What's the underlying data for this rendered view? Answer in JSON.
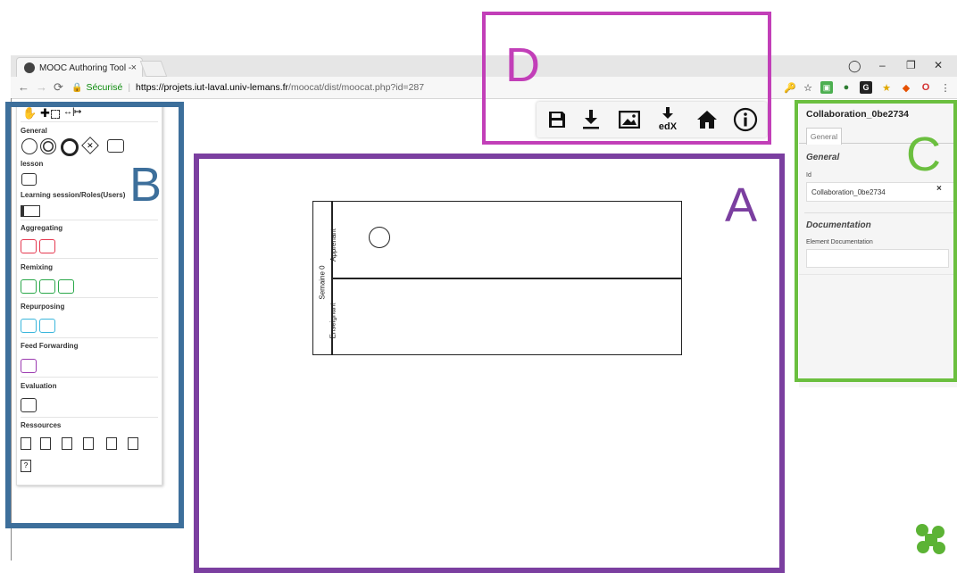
{
  "browser": {
    "tab_title": "MOOC Authoring Tool - ",
    "tab_close": "×",
    "secure_label": "Sécurisé",
    "url_host": "https://projets.iut-laval.univ-lemans.fr",
    "url_path": "/moocat/dist/moocat.php?id=287",
    "window_controls": [
      "–",
      "❐",
      "✕"
    ]
  },
  "palette": {
    "sections": {
      "general": "General",
      "lesson": "lesson",
      "learning_session": "Learning session/Roles(Users)",
      "aggregating": "Aggregating",
      "remixing": "Remixing",
      "repurposing": "Repurposing",
      "feed_forwarding": "Feed Forwarding",
      "evaluation": "Evaluation",
      "ressources": "Ressources"
    },
    "colors": {
      "aggregating": "#e53950",
      "remixing": "#2aa84a",
      "repurposing": "#3ab6dc",
      "feed_forwarding": "#9b3ab0"
    }
  },
  "canvas": {
    "pool_label": "Semaine 0",
    "lane1_label": "Apprenant",
    "lane2_label": "Enseignant"
  },
  "properties": {
    "element_title": "Collaboration_0be2734",
    "tab_general": "General",
    "group_general": "General",
    "id_label": "Id",
    "id_value": "Collaboration_0be2734",
    "clear_icon": "×",
    "group_documentation": "Documentation",
    "doc_label": "Element Documentation"
  },
  "toolbar": {
    "icons": [
      "save-icon",
      "download-icon",
      "image-icon",
      "edx-export-icon",
      "home-icon",
      "info-icon"
    ],
    "edx_label": "edX"
  },
  "annotations": {
    "A": "A",
    "B": "B",
    "C": "C",
    "D": "D",
    "colors": {
      "A": "#7b3fa0",
      "B": "#3d6f9b",
      "C": "#6bbf3f",
      "D": "#c23fb8"
    }
  }
}
